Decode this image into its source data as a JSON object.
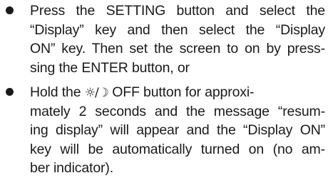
{
  "items": [
    {
      "lines": [
        "Press the SETTING button and select the",
        "“Display” key and then select the “Display",
        "ON” key. Then set the screen to on by press-",
        "sing the ENTER button, or"
      ]
    },
    {
      "line1_before_icon": "Hold the ",
      "icon_glyph": "☼/☽",
      "line1_after_icon": " OFF button for approxi-",
      "lines_rest": [
        "mately 2 seconds and the message “resum-",
        "ing display” will appear and the “Display ON”",
        "key will be automatically turned on (no am-",
        "ber indicator)."
      ]
    }
  ]
}
